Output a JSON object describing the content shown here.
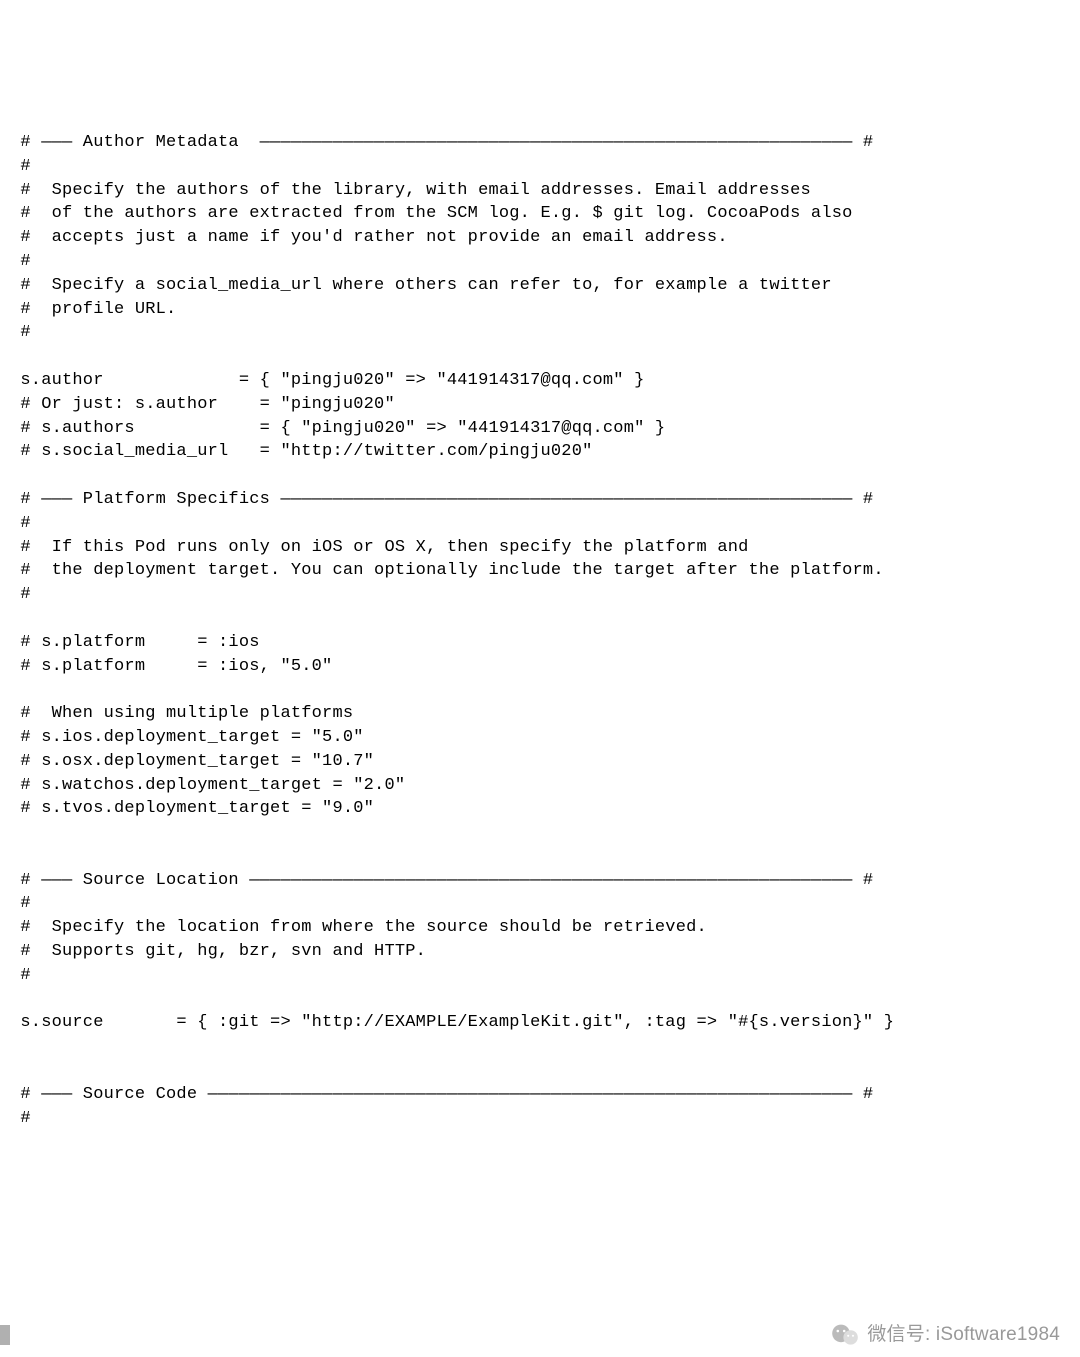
{
  "sections": {
    "author": {
      "header": " # ――― Author Metadata  ――――――――――――――――――――――――――――――――――――――――――――――――――――――――― #",
      "blank1": " #",
      "desc1": " #  Specify the authors of the library, with email addresses. Email addresses",
      "desc2": " #  of the authors are extracted from the SCM log. E.g. $ git log. CocoaPods also",
      "desc3": " #  accepts just a name if you'd rather not provide an email address.",
      "blank2": " #",
      "desc4": " #  Specify a social_media_url where others can refer to, for example a twitter",
      "desc5": " #  profile URL.",
      "blank3": " #",
      "blank4": "",
      "code1": " s.author             = { \"pingju020\" => \"441914317@qq.com\" }",
      "code2": " # Or just: s.author    = \"pingju020\"",
      "code3": " # s.authors            = { \"pingju020\" => \"441914317@qq.com\" }",
      "code4": " # s.social_media_url   = \"http://twitter.com/pingju020\"",
      "blank5": ""
    },
    "platform": {
      "header": " # ――― Platform Specifics ――――――――――――――――――――――――――――――――――――――――――――――――――――――― #",
      "blank1": " #",
      "desc1": " #  If this Pod runs only on iOS or OS X, then specify the platform and",
      "desc2": " #  the deployment target. You can optionally include the target after the platform.",
      "blank2": " #",
      "blank3": "",
      "code1": " # s.platform     = :ios",
      "code2": " # s.platform     = :ios, \"5.0\"",
      "blank4": "",
      "code3": " #  When using multiple platforms",
      "code4": " # s.ios.deployment_target = \"5.0\"",
      "code5": " # s.osx.deployment_target = \"10.7\"",
      "code6": " # s.watchos.deployment_target = \"2.0\"",
      "code7": " # s.tvos.deployment_target = \"9.0\"",
      "blank5": "",
      "blank6": ""
    },
    "source_location": {
      "header": " # ――― Source Location ―――――――――――――――――――――――――――――――――――――――――――――――――――――――――― #",
      "blank1": " #",
      "desc1": " #  Specify the location from where the source should be retrieved.",
      "desc2": " #  Supports git, hg, bzr, svn and HTTP.",
      "blank2": " #",
      "blank3": "",
      "code1": " s.source       = { :git => \"http://EXAMPLE/ExampleKit.git\", :tag => \"#{s.version}\" }",
      "blank4": "",
      "blank5": ""
    },
    "source_code": {
      "header": " # ――― Source Code ―――――――――――――――――――――――――――――――――――――――――――――――――――――――――――――― #",
      "blank1": " #"
    }
  },
  "watermark": {
    "text": "微信号: iSoftware1984"
  }
}
